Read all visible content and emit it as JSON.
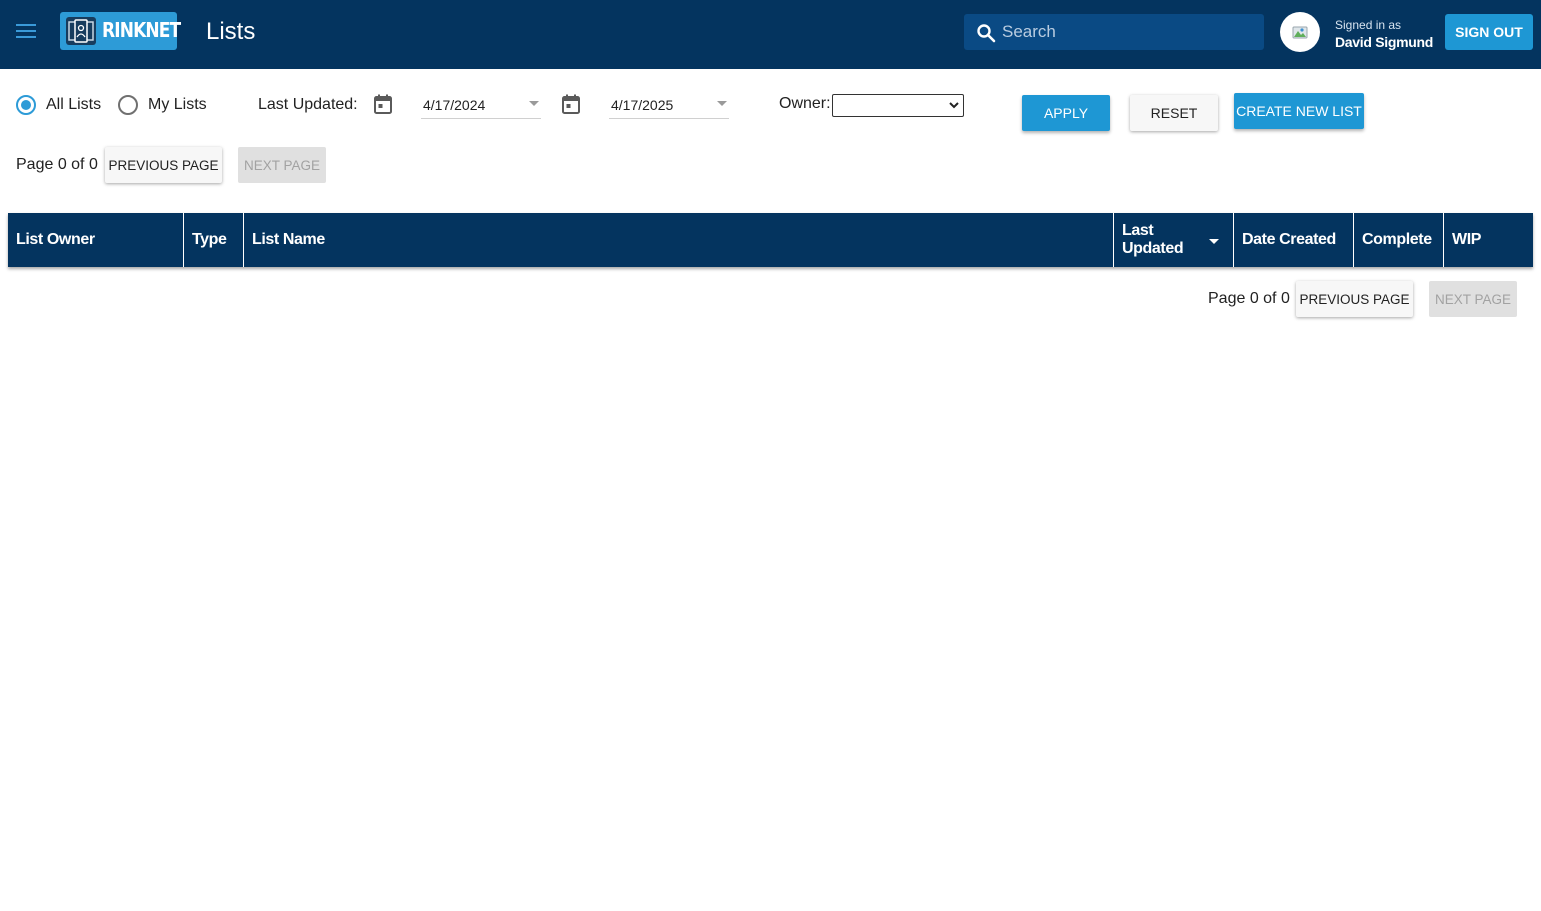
{
  "header": {
    "logo_text": "RINKNET",
    "page_title": "Lists",
    "search_placeholder": "Search",
    "signed_in_label": "Signed in as",
    "user_name": "David Sigmund",
    "sign_out_label": "SIGN OUT",
    "colors": {
      "bar": "#04345f",
      "accent": "#1e97d4"
    }
  },
  "filters": {
    "all_lists_label": "All Lists",
    "my_lists_label": "My Lists",
    "selected_scope": "All Lists",
    "last_updated_label": "Last Updated:",
    "date_from": "4/17/2024",
    "date_to": "4/17/2025",
    "owner_label": "Owner:",
    "owner_value": "",
    "apply_label": "APPLY",
    "reset_label": "RESET",
    "create_label": "CREATE NEW LIST"
  },
  "pagination": {
    "page_text": "Page 0 of 0",
    "previous_label": "PREVIOUS PAGE",
    "next_label": "NEXT PAGE",
    "next_disabled": true
  },
  "table": {
    "columns": [
      "List Owner",
      "Type",
      "List Name",
      "Last Updated",
      "Date Created",
      "Complete",
      "WIP"
    ],
    "sorted_column": "Last Updated",
    "sort_direction": "descending",
    "rows": []
  }
}
